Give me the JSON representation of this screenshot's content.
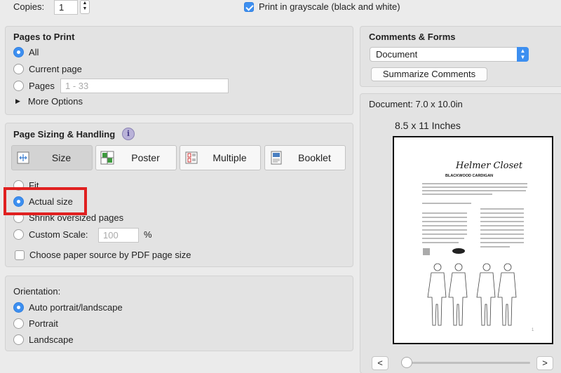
{
  "copies": {
    "label": "Copies:",
    "value": "1"
  },
  "grayscale": {
    "label": "Print in grayscale (black and white)",
    "checked": true
  },
  "pages_to_print": {
    "title": "Pages to Print",
    "all": "All",
    "current_page": "Current page",
    "pages": "Pages",
    "pages_placeholder": "1 - 33",
    "more_options": "More Options"
  },
  "sizing": {
    "title": "Page Sizing & Handling",
    "tabs": [
      "Size",
      "Poster",
      "Multiple",
      "Booklet"
    ],
    "fit": "Fit",
    "actual_size": "Actual size",
    "shrink": "Shrink oversized pages",
    "custom_scale": "Custom Scale:",
    "scale_value": "100",
    "percent": "%",
    "paper_source": "Choose paper source by PDF page size"
  },
  "orientation": {
    "title": "Orientation:",
    "auto": "Auto portrait/landscape",
    "portrait": "Portrait",
    "landscape": "Landscape"
  },
  "comments_forms": {
    "title": "Comments & Forms",
    "selected": "Document",
    "summarize": "Summarize Comments"
  },
  "preview": {
    "document_size": "Document: 7.0 x 10.0in",
    "paper_size": "8.5 x 11 Inches",
    "doc_script_title": "Helmer Closet",
    "doc_subtitle": "BLACKWOOD CARDIGAN",
    "page_number": "1",
    "prev": "<",
    "next": ">"
  },
  "colors": {
    "accent": "#3d8ff0",
    "highlight": "#e02020"
  }
}
